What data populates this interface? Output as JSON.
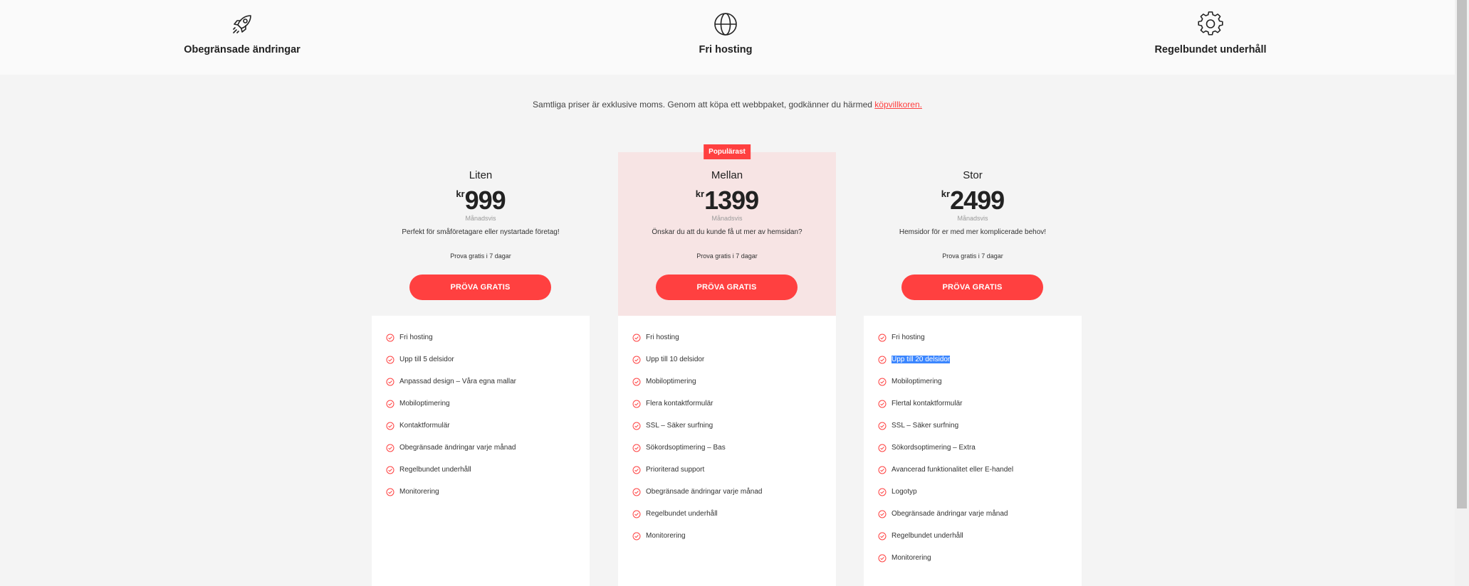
{
  "features_bar": {
    "items": [
      {
        "icon": "rocket-icon",
        "label": "Obegränsade ändringar"
      },
      {
        "icon": "globe-icon",
        "label": "Fri hosting"
      },
      {
        "icon": "gear-icon",
        "label": "Regelbundet underhåll"
      }
    ]
  },
  "disclaimer": {
    "text": "Samtliga priser är exklusive moms. Genom att köpa ett webbpaket, godkänner du härmed ",
    "link": "köpvillkoren."
  },
  "colors": {
    "accent": "#ff4040",
    "popular_bg": "#f7e4e4",
    "highlight": "#3b86ff"
  },
  "plans": [
    {
      "name": "Liten",
      "currency": "kr",
      "price": "999",
      "period": "Månadsvis",
      "description": "Perfekt för småföretagare eller nystartade företag!",
      "trial": "Prova gratis i 7 dagar",
      "cta": "PRÖVA GRATIS",
      "features": [
        "Fri hosting",
        "Upp till 5 delsidor",
        "Anpassad design – Våra egna mallar",
        "Mobiloptimering",
        "Kontaktformulär",
        "Obegränsade ändringar varje månad",
        "Regelbundet underhåll",
        "Monitorering"
      ]
    },
    {
      "name": "Mellan",
      "badge": "Populärast",
      "currency": "kr",
      "price": "1399",
      "period": "Månadsvis",
      "description": "Önskar du att du kunde få ut mer av hemsidan?",
      "trial": "Prova gratis i 7 dagar",
      "cta": "PRÖVA GRATIS",
      "features": [
        "Fri hosting",
        "Upp till 10 delsidor",
        "Mobiloptimering",
        "Flera kontaktformulär",
        "SSL – Säker surfning",
        "Sökordsoptimering – Bas",
        "Prioriterad support",
        "Obegränsade ändringar varje månad",
        "Regelbundet underhåll",
        "Monitorering"
      ]
    },
    {
      "name": "Stor",
      "currency": "kr",
      "price": "2499",
      "period": "Månadsvis",
      "description": "Hemsidor för er med mer komplicerade behov!",
      "trial": "Prova gratis i 7 dagar",
      "cta": "PRÖVA GRATIS",
      "features": [
        "Fri hosting",
        "Upp till 20 delsidor",
        "Mobiloptimering",
        "Flertal kontaktformulär",
        "SSL – Säker surfning",
        "Sökordsoptimering – Extra",
        "Avancerad funktionalitet eller E-handel",
        "Logotyp",
        "Obegränsade ändringar varje månad",
        "Regelbundet underhåll",
        "Monitorering"
      ],
      "selected_feature": "Upp till 20 delsidor"
    }
  ]
}
